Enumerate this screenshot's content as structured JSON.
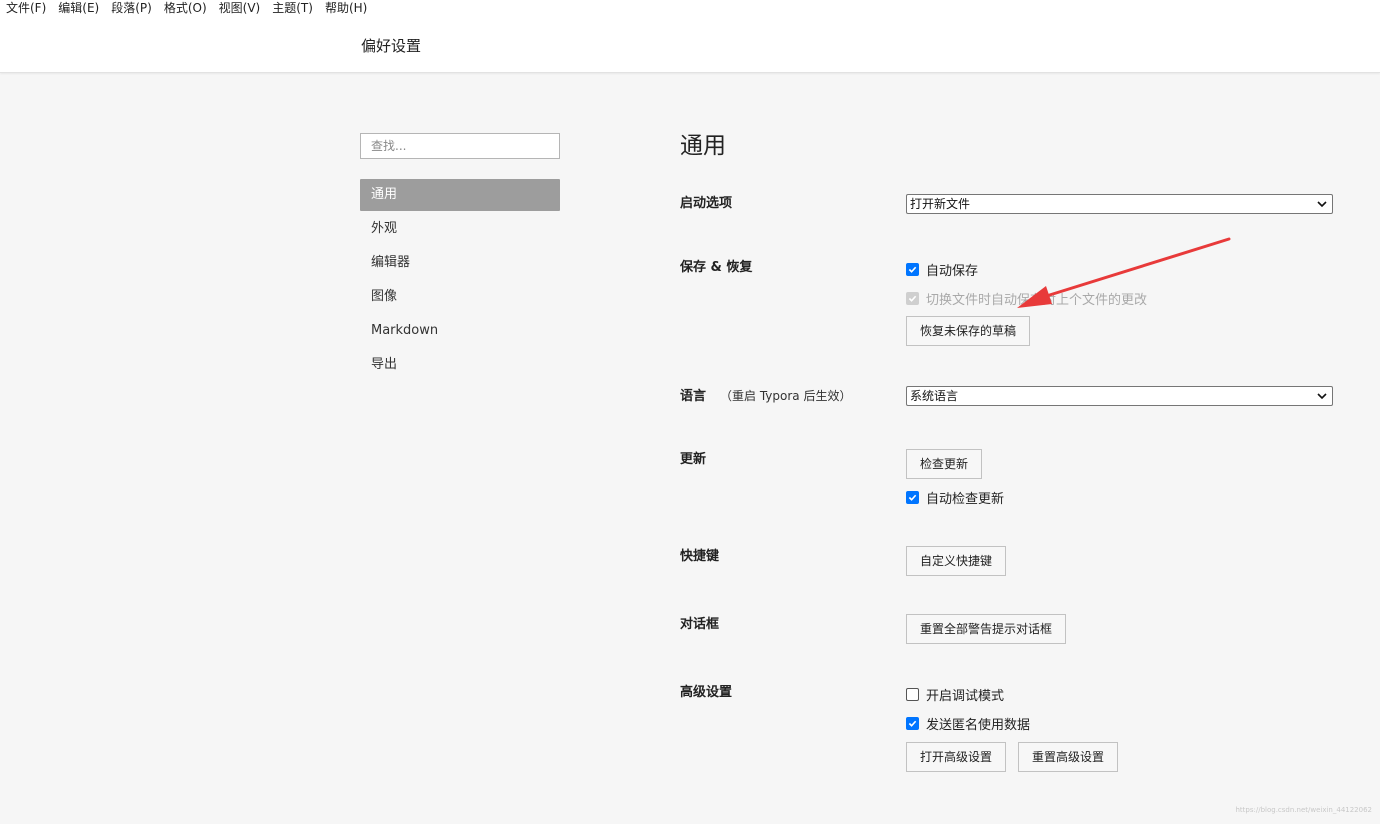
{
  "menubar": {
    "items": [
      {
        "label": "文件(F)"
      },
      {
        "label": "编辑(E)"
      },
      {
        "label": "段落(P)"
      },
      {
        "label": "格式(O)"
      },
      {
        "label": "视图(V)"
      },
      {
        "label": "主题(T)"
      },
      {
        "label": "帮助(H)"
      }
    ]
  },
  "window": {
    "title": "偏好设置"
  },
  "sidebar": {
    "search_placeholder": "查找...",
    "items": [
      {
        "label": "通用",
        "active": true
      },
      {
        "label": "外观"
      },
      {
        "label": "编辑器"
      },
      {
        "label": "图像"
      },
      {
        "label": "Markdown"
      },
      {
        "label": "导出"
      }
    ]
  },
  "main": {
    "title": "通用",
    "startup": {
      "label": "启动选项",
      "selected": "打开新文件"
    },
    "save_restore": {
      "label": "保存 & 恢复",
      "autosave": {
        "label": "自动保存",
        "checked": true
      },
      "autosave_on_switch": {
        "label": "切换文件时自动保存对上个文件的更改",
        "checked": true,
        "disabled": true
      },
      "restore_button": "恢复未保存的草稿"
    },
    "language": {
      "label": "语言",
      "note": "（重启 Typora 后生效）",
      "selected": "系统语言"
    },
    "update": {
      "label": "更新",
      "check_button": "检查更新",
      "auto_check": {
        "label": "自动检查更新",
        "checked": true
      }
    },
    "shortcuts": {
      "label": "快捷键",
      "button": "自定义快捷键"
    },
    "dialogs": {
      "label": "对话框",
      "button": "重置全部警告提示对话框"
    },
    "advanced": {
      "label": "高级设置",
      "debug": {
        "label": "开启调试模式",
        "checked": false
      },
      "telemetry": {
        "label": "发送匿名使用数据",
        "checked": true
      },
      "open_button": "打开高级设置",
      "reset_button": "重置高级设置"
    }
  },
  "colors": {
    "accent": "#0075ff",
    "arrow": "#e83a3a",
    "nav_active": "#9d9d9d"
  },
  "watermark": "https://blog.csdn.net/weixin_44122062"
}
